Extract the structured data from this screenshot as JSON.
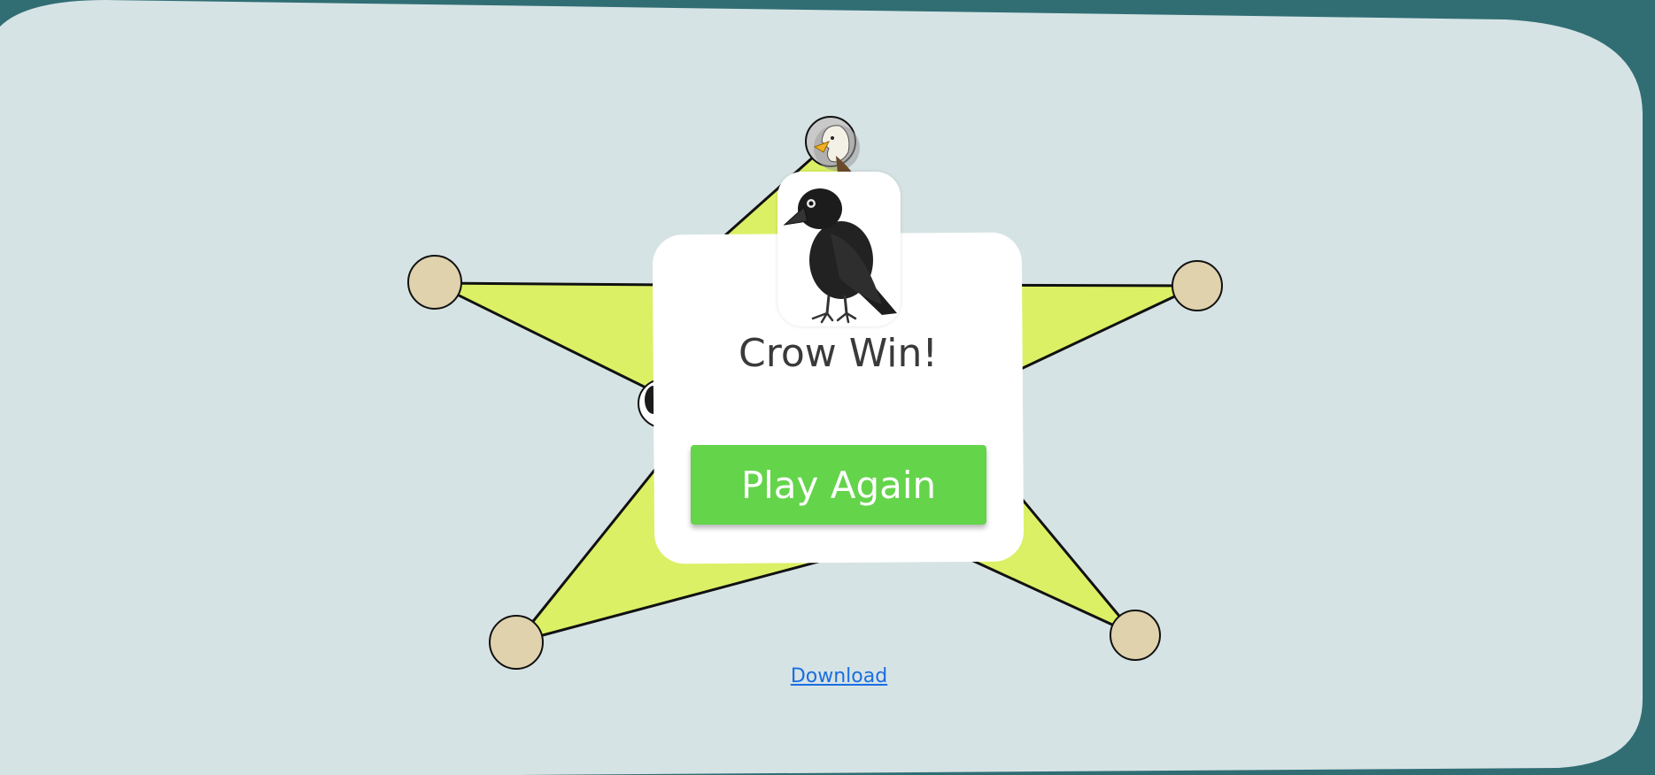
{
  "game": {
    "winner_icon": "crow-icon",
    "opponent_icon": "eagle-icon"
  },
  "result": {
    "title": "Crow Win!",
    "play_again_label": "Play Again"
  },
  "footer": {
    "download_label": "Download"
  },
  "colors": {
    "background_outer": "#306e74",
    "board_panel": "#d6e3e5",
    "star_fill": "#dbf065",
    "node_fill": "#dfd2ac",
    "play_button": "#64d44b",
    "link": "#1a6ee0"
  }
}
